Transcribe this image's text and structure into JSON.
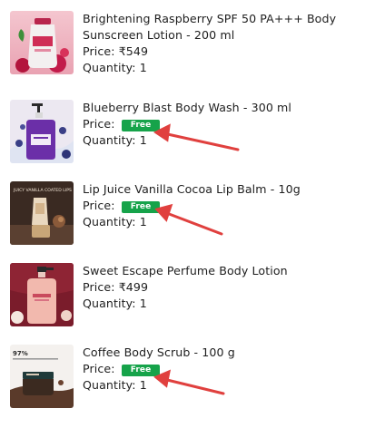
{
  "colors": {
    "free_badge": "#16a34a",
    "arrow": "#e0403e",
    "text": "#1e1e1e"
  },
  "items": [
    {
      "name": "Brightening Raspberry SPF 50 PA+++ Body Sunscreen Lotion - 200 ml",
      "price_label": "Price:",
      "price": "₹549",
      "free": false,
      "quantity": "Quantity: 1",
      "image_icon": "sunscreen-bottle"
    },
    {
      "name": "Blueberry Blast Body Wash - 300 ml",
      "price_label": "Price:",
      "price": "Free",
      "free": true,
      "quantity": "Quantity: 1",
      "image_icon": "body-wash-pump-bottle"
    },
    {
      "name": "Lip Juice Vanilla Cocoa Lip Balm - 10g",
      "price_label": "Price:",
      "price": "Free",
      "free": true,
      "quantity": "Quantity: 1",
      "image_icon": "lip-balm-tube",
      "image_text": "JUICY VANILLA COATED LIPS"
    },
    {
      "name": "Sweet Escape Perfume Body Lotion",
      "price_label": "Price:",
      "price": "₹499",
      "free": false,
      "quantity": "Quantity: 1",
      "image_icon": "lotion-pump-bottle"
    },
    {
      "name": "Coffee Body Scrub - 100 g",
      "price_label": "Price:",
      "price": "Free",
      "free": true,
      "quantity": "Quantity: 1",
      "image_icon": "scrub-jar",
      "image_text": "97%"
    }
  ]
}
